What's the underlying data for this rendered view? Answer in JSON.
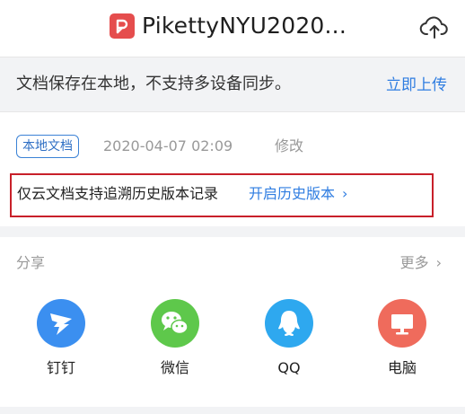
{
  "header": {
    "title": "PikettyNYU2020...",
    "file_icon": "pdf-file-icon",
    "upload_icon": "cloud-upload-icon"
  },
  "banner": {
    "text": "文档保存在本地，不支持多设备同步。",
    "link": "立即上传"
  },
  "meta": {
    "badge": "本地文档",
    "date": "2020-04-07 02:09",
    "edit": "修改"
  },
  "history": {
    "text": "仅云文档支持追溯历史版本记录",
    "link": "开启历史版本",
    "chevron": "›"
  },
  "share": {
    "label": "分享",
    "more": "更多",
    "more_chevron": "›",
    "items": [
      {
        "name": "钉钉",
        "icon": "dingtalk-icon",
        "color": "#3b8ff0"
      },
      {
        "name": "微信",
        "icon": "wechat-icon",
        "color": "#5ec84b"
      },
      {
        "name": "QQ",
        "icon": "qq-icon",
        "color": "#2ea8ef"
      },
      {
        "name": "电脑",
        "icon": "computer-icon",
        "color": "#ef6b5c"
      }
    ]
  },
  "colors": {
    "accent": "#2f7de1",
    "highlight_border": "#c8202a",
    "banner_bg": "#f2f3f5"
  }
}
